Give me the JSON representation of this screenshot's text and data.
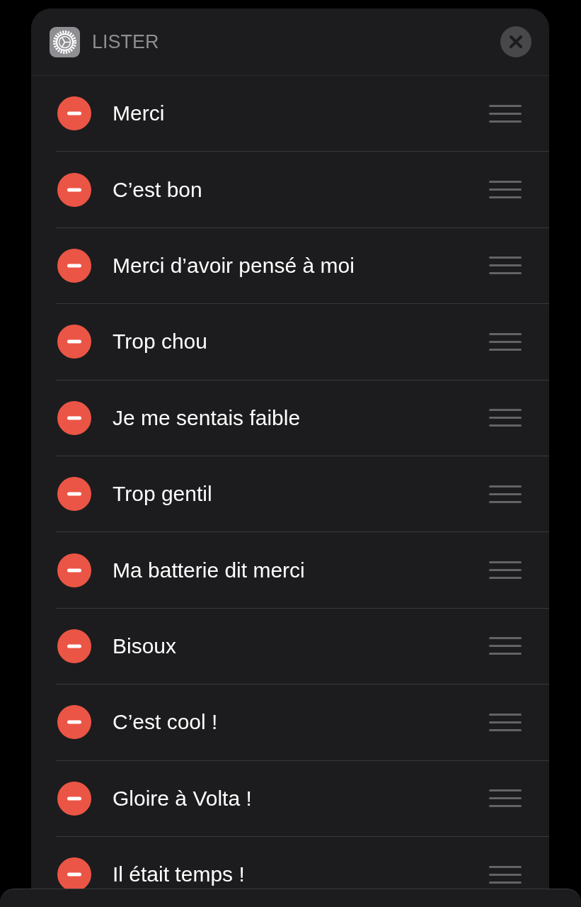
{
  "header": {
    "title": "LISTER"
  },
  "items": [
    {
      "label": "Merci"
    },
    {
      "label": "C’est bon"
    },
    {
      "label": "Merci d’avoir pensé à moi"
    },
    {
      "label": "Trop chou"
    },
    {
      "label": "Je me sentais faible"
    },
    {
      "label": "Trop gentil"
    },
    {
      "label": "Ma batterie dit merci"
    },
    {
      "label": "Bisoux"
    },
    {
      "label": "C’est cool !"
    },
    {
      "label": "Gloire à Volta !"
    },
    {
      "label": "Il était temps !"
    }
  ]
}
